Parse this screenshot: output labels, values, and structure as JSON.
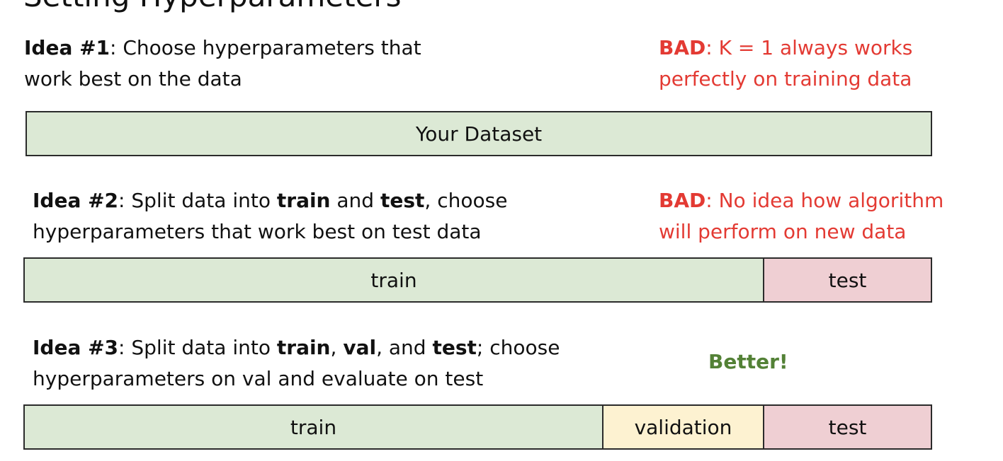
{
  "slide": {
    "title_partial": "Setting Hyperparameters",
    "idea1": {
      "label": "Idea #1",
      "line1": ": Choose hyperparameters that",
      "line2": "work best on the data",
      "verdict_label": "BAD",
      "verdict_line1": ": K = 1 always works",
      "verdict_line2": "perfectly on training data"
    },
    "bar1": {
      "segments": [
        {
          "label": "Your Dataset",
          "color": "#dce9d5"
        }
      ]
    },
    "idea2": {
      "label": "Idea #2",
      "t1": ": Split data into ",
      "t2": "train",
      "t3": " and ",
      "t4": "test",
      "t5": ", choose",
      "line2": "hyperparameters that work best on test data",
      "verdict_label": "BAD",
      "verdict_line1": ": No idea how algorithm",
      "verdict_line2": "will perform on new data"
    },
    "bar2": {
      "segments": [
        {
          "label": "train",
          "color": "#dce9d5"
        },
        {
          "label": "test",
          "color": "#efcfd3"
        }
      ]
    },
    "idea3": {
      "label": "Idea #3",
      "t1": ": Split data into ",
      "t2": "train",
      "t3": ", ",
      "t4": "val",
      "t5": ", and ",
      "t6": "test",
      "t7": "; choose",
      "line2": "hyperparameters on val and evaluate on test",
      "verdict": "Better!"
    },
    "bar3": {
      "segments": [
        {
          "label": "train",
          "color": "#dce9d5"
        },
        {
          "label": "validation",
          "color": "#fdf2d1"
        },
        {
          "label": "test",
          "color": "#efcfd3"
        }
      ]
    }
  }
}
